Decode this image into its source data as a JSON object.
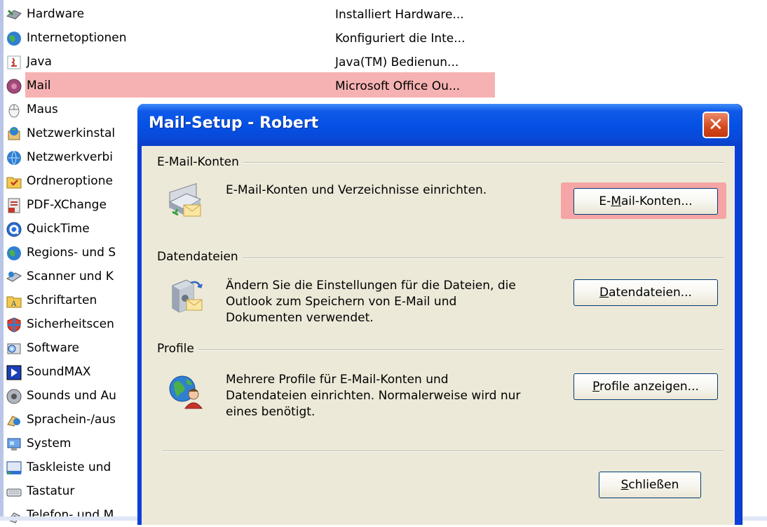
{
  "control_panel": {
    "items": [
      {
        "label": "Hardware",
        "icon": "hardware-icon"
      },
      {
        "label": "Internetoptionen",
        "icon": "globe-icon"
      },
      {
        "label": "Java",
        "icon": "java-icon"
      },
      {
        "label": "Mail",
        "icon": "mail-icon"
      },
      {
        "label": "Maus",
        "icon": "mouse-icon"
      },
      {
        "label": "Netzwerkinstal",
        "icon": "network-setup-icon"
      },
      {
        "label": "Netzwerkverbi",
        "icon": "network-connections-icon"
      },
      {
        "label": "Ordneroptione",
        "icon": "folder-options-icon"
      },
      {
        "label": "PDF-XChange",
        "icon": "pdf-icon"
      },
      {
        "label": "QuickTime",
        "icon": "quicktime-icon"
      },
      {
        "label": "Regions- und S",
        "icon": "globe-icon"
      },
      {
        "label": "Scanner und K",
        "icon": "scanner-icon"
      },
      {
        "label": "Schriftarten",
        "icon": "fonts-folder-icon"
      },
      {
        "label": "Sicherheitscen",
        "icon": "shield-icon"
      },
      {
        "label": "Software",
        "icon": "software-icon"
      },
      {
        "label": "SoundMAX",
        "icon": "soundmax-icon"
      },
      {
        "label": "Sounds und Au",
        "icon": "speaker-icon"
      },
      {
        "label": "Sprachein-/aus",
        "icon": "speech-icon"
      },
      {
        "label": "System",
        "icon": "system-icon"
      },
      {
        "label": "Taskleiste und",
        "icon": "taskbar-icon"
      },
      {
        "label": "Tastatur",
        "icon": "keyboard-icon"
      },
      {
        "label": "Telefon- und M",
        "icon": "phone-icon"
      }
    ],
    "descriptions": [
      "Installiert Hardware...",
      "Konfiguriert die Inte...",
      "Java(TM) Bedienun...",
      "Microsoft Office Ou..."
    ]
  },
  "dialog": {
    "title": "Mail-Setup - Robert",
    "groups": [
      {
        "title": "E-Mail-Konten",
        "text": [
          "E-Mail-Konten und Verzeichnisse einrichten."
        ],
        "button": {
          "pre": "E-",
          "key": "M",
          "post": "ail-Konten..."
        },
        "icon": "mail-accounts-icon"
      },
      {
        "title": "Datendateien",
        "text": [
          "Ändern Sie die Einstellungen für die Dateien, die",
          "Outlook zum Speichern von E-Mail und",
          "Dokumenten verwendet."
        ],
        "button": {
          "pre": "",
          "key": "D",
          "post": "atendateien..."
        },
        "icon": "data-files-icon"
      },
      {
        "title": "Profile",
        "text": [
          "Mehrere Profile für E-Mail-Konten und",
          "Datendateien einrichten. Normalerweise wird nur",
          "eines benötigt."
        ],
        "button": {
          "pre": "",
          "key": "P",
          "post": "rofile anzeigen..."
        },
        "icon": "profiles-icon"
      }
    ],
    "close_button": {
      "pre": "",
      "key": "S",
      "post": "chließen"
    }
  },
  "colors": {
    "highlight": "#f5a5a5",
    "titlebar": "#0450e4",
    "dialog_bg": "#ece9d8"
  }
}
